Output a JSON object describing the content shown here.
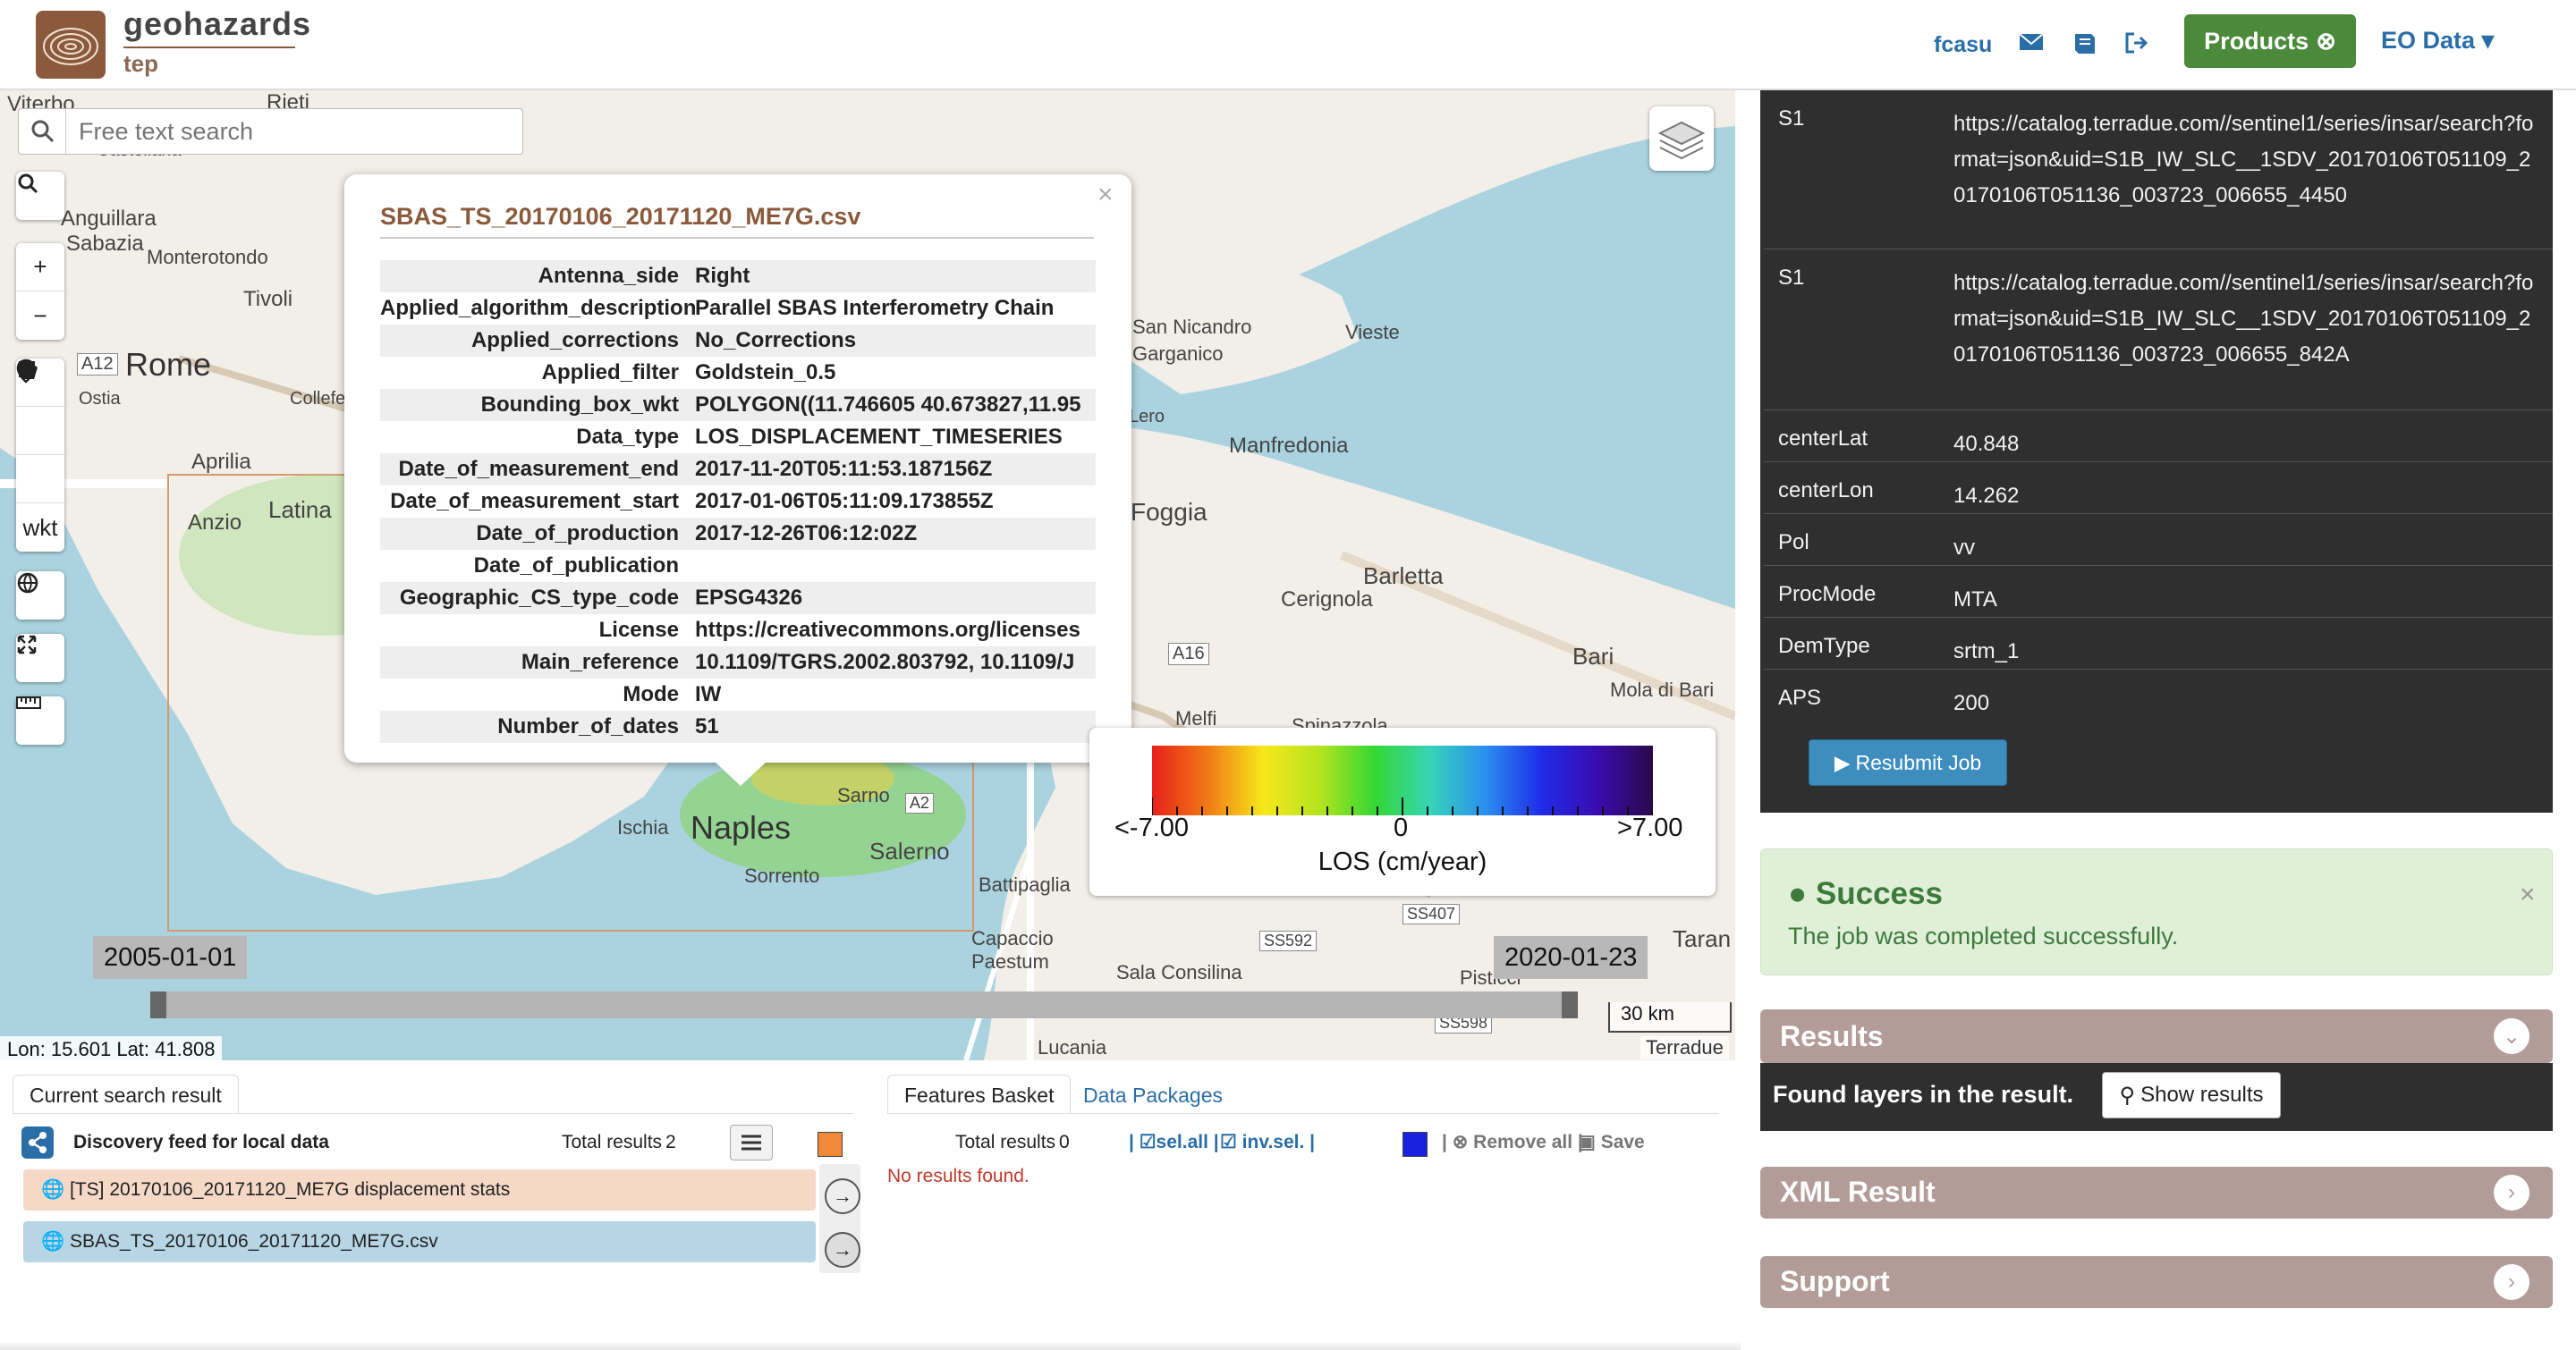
{
  "header": {
    "logo_name": "geohazards",
    "logo_sub": "tep",
    "user": "fcasu",
    "products_label": "Products",
    "eo_label": "EO Data",
    "icons": [
      "envelope-icon",
      "book-icon",
      "sign-out-icon"
    ]
  },
  "map": {
    "search_placeholder": "Free text search",
    "tools": {
      "wkt": "wkt",
      "zoom_in": "+",
      "zoom_out": "−"
    },
    "labels": [
      "Viterbo",
      "Rieti",
      "Castellana",
      "Anguillara",
      "Sabazia",
      "Monterotondo",
      "Tivoli",
      "A12",
      "Rome",
      "Ostia",
      "Colleferro",
      "Aprilia",
      "Latina",
      "Anzio",
      "San Nicandro",
      "Garganico",
      "Vieste",
      "Lero",
      "Manfredonia",
      "Foggia",
      "Barletta",
      "Cerignola",
      "A16",
      "Bari",
      "Mola di Bari",
      "Melfi",
      "Spinazzola",
      "Ischia",
      "Naples",
      "Sarno",
      "A2",
      "Salerno",
      "Sorrento",
      "Battipaglia",
      "Capaccio",
      "Paestum",
      "SS592",
      "Sala Consilina",
      "SS407",
      "Pisticci",
      "Taran",
      "Lucania",
      "SS598"
    ],
    "coords": "Lon: 15.601 Lat: 41.808",
    "scale": "30 km",
    "attribution": "Terradue",
    "time_start": "2005-01-01",
    "time_end": "2020-01-23"
  },
  "popup": {
    "title": "SBAS_TS_20170106_20171120_ME7G.csv",
    "rows": [
      {
        "k": "Antenna_side",
        "v": "Right"
      },
      {
        "k": "Applied_algorithm_description",
        "v": "Parallel SBAS Interferometry Chain"
      },
      {
        "k": "Applied_corrections",
        "v": "No_Corrections"
      },
      {
        "k": "Applied_filter",
        "v": "Goldstein_0.5"
      },
      {
        "k": "Bounding_box_wkt",
        "v": "POLYGON((11.746605 40.673827,11.95"
      },
      {
        "k": "Data_type",
        "v": "LOS_DISPLACEMENT_TIMESERIES"
      },
      {
        "k": "Date_of_measurement_end",
        "v": "2017-11-20T05:11:53.187156Z"
      },
      {
        "k": "Date_of_measurement_start",
        "v": "2017-01-06T05:11:09.173855Z"
      },
      {
        "k": "Date_of_production",
        "v": "2017-12-26T06:12:02Z"
      },
      {
        "k": "Date_of_publication",
        "v": ""
      },
      {
        "k": "Geographic_CS_type_code",
        "v": "EPSG4326"
      },
      {
        "k": "License",
        "v": "https://creativecommons.org/licenses"
      },
      {
        "k": "Main_reference",
        "v": "10.1109/TGRS.2002.803792, 10.1109/J"
      },
      {
        "k": "Mode",
        "v": "IW"
      },
      {
        "k": "Number_of_dates",
        "v": "51"
      }
    ]
  },
  "legend": {
    "min": "<-7.00",
    "mid": "0",
    "max": ">7.00",
    "title": "LOS (cm/year)"
  },
  "right": {
    "rows": [
      {
        "k": "S1",
        "v": "https://catalog.terradue.com//sentinel1/series/insar/search?format=json&uid=S1B_IW_SLC__1SDV_20170106T051109_20170106T051136_003723_006655_4450"
      },
      {
        "k": "S1",
        "v": "https://catalog.terradue.com//sentinel1/series/insar/search?format=json&uid=S1B_IW_SLC__1SDV_20170106T051109_20170106T051136_003723_006655_842A"
      },
      {
        "k": "centerLat",
        "v": "40.848"
      },
      {
        "k": "centerLon",
        "v": "14.262"
      },
      {
        "k": "Pol",
        "v": "vv"
      },
      {
        "k": "ProcMode",
        "v": "MTA"
      },
      {
        "k": "DemType",
        "v": "srtm_1"
      },
      {
        "k": "APS",
        "v": "200"
      }
    ],
    "resubmit": "Resubmit Job",
    "success_title": "Success",
    "success_text": "The job was completed successfully.",
    "results_title": "Results",
    "found_text": "Found layers in the result.",
    "show_results": "Show results",
    "xml_title": "XML Result",
    "support_title": "Support"
  },
  "bottom": {
    "tab_current": "Current search result",
    "feed_title": "Discovery feed for local data",
    "total_results": "Total results",
    "total_count": "2",
    "items": [
      "[TS] 20170106_20171120_ME7G displacement stats",
      "SBAS_TS_20170106_20171120_ME7G.csv"
    ],
    "tab_basket": "Features Basket",
    "tab_packages": "Data Packages",
    "basket_total": "Total results",
    "basket_count": "0",
    "sel_all": "sel.all",
    "inv_sel": "inv.sel.",
    "remove_all": "Remove all",
    "save": "Save",
    "no_results": "No results found."
  },
  "colors": {
    "accent": "#8b5a3c",
    "brand_green": "#4a8a3a",
    "link": "#2a6ea8",
    "item_orange": "#f6d8c6",
    "item_blue": "#b6d6e6"
  }
}
